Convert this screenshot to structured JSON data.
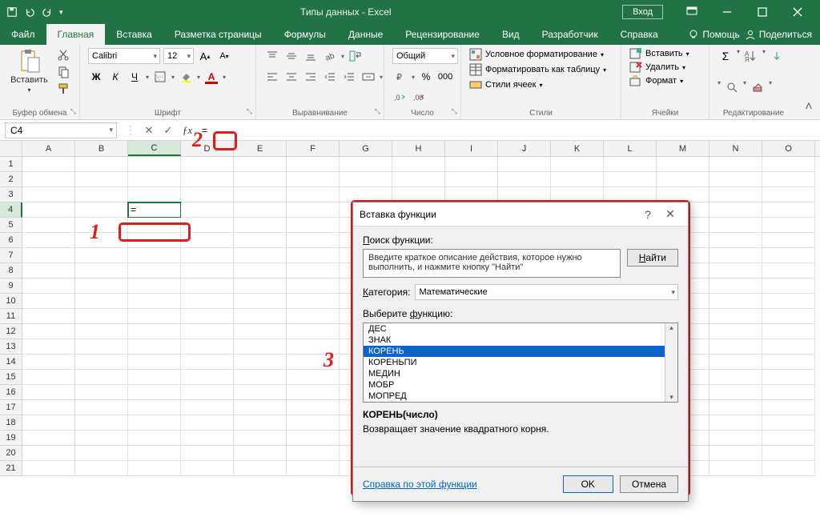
{
  "titlebar": {
    "title": "Типы данных  -  Excel",
    "login": "Вход"
  },
  "tabs": {
    "file": "Файл",
    "home": "Главная",
    "insert": "Вставка",
    "layout": "Разметка страницы",
    "formulas": "Формулы",
    "data": "Данные",
    "review": "Рецензирование",
    "view": "Вид",
    "developer": "Разработчик",
    "help": "Справка",
    "tellme": "Помощь",
    "share": "Поделиться"
  },
  "ribbon": {
    "clipboard": {
      "label": "Буфер обмена",
      "paste": "Вставить"
    },
    "font": {
      "label": "Шрифт",
      "name": "Calibri",
      "size": "12",
      "bold": "Ж",
      "italic": "К",
      "underline": "Ч"
    },
    "alignment": {
      "label": "Выравнивание"
    },
    "number": {
      "label": "Число",
      "format": "Общий"
    },
    "styles": {
      "label": "Стили",
      "cond": "Условное форматирование",
      "table": "Форматировать как таблицу",
      "cell": "Стили ячеек"
    },
    "cells": {
      "label": "Ячейки",
      "insert": "Вставить",
      "delete": "Удалить",
      "format": "Формат"
    },
    "editing": {
      "label": "Редактирование"
    }
  },
  "formula_bar": {
    "namebox": "C4",
    "formula": "="
  },
  "grid": {
    "columns": [
      "A",
      "B",
      "C",
      "D",
      "E",
      "F",
      "G",
      "H",
      "I",
      "J",
      "K",
      "L",
      "M",
      "N",
      "O"
    ],
    "active_cell_value": "="
  },
  "dialog": {
    "title": "Вставка функции",
    "search_label": "Поиск функции:",
    "search_text": "Введите краткое описание действия, которое нужно выполнить, и нажмите кнопку \"Найти\"",
    "find_btn": "Найти",
    "category_label": "Категория:",
    "category_value": "Математические",
    "select_label": "Выберите функцию:",
    "functions": [
      "ДЕС",
      "ЗНАК",
      "КОРЕНЬ",
      "КОРЕНЬПИ",
      "МЕДИН",
      "МОБР",
      "МОПРЕД"
    ],
    "selected_index": 2,
    "signature": "КОРЕНЬ(число)",
    "description": "Возвращает значение квадратного корня.",
    "help_link": "Справка по этой функции",
    "ok": "OK",
    "cancel": "Отмена"
  },
  "annotations": {
    "a1": "1",
    "a2": "2",
    "a3": "3"
  }
}
